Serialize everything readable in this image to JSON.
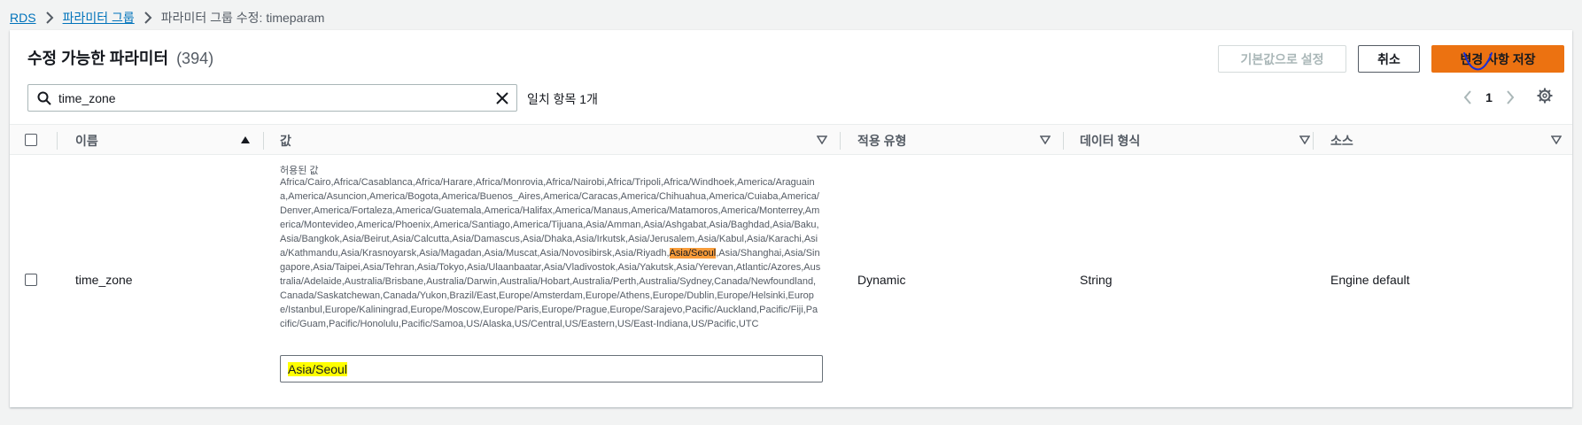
{
  "breadcrumb": {
    "root": "RDS",
    "parent": "파라미터 그룹",
    "current": "파라미터 그룹 수정: timeparam"
  },
  "panel": {
    "title": "수정 가능한 파라미터",
    "count": "(394)",
    "buttons": {
      "reset": "기본값으로 설정",
      "cancel": "취소",
      "save": "변경 사항 저장"
    }
  },
  "search": {
    "value": "time_zone",
    "match_text": "일치 항목 1개"
  },
  "pagination": {
    "current_page": "1"
  },
  "table": {
    "columns": {
      "name": "이름",
      "value": "값",
      "apply_type": "적용 유형",
      "data_type": "데이터 형식",
      "source": "소스"
    },
    "rows": [
      {
        "name": "time_zone",
        "allowed_label": "허용된 값",
        "allowed_before": "Africa/Cairo,Africa/Casablanca,Africa/Harare,Africa/Monrovia,Africa/Nairobi,Africa/Tripoli,Africa/Windhoek,America/Araguaina,America/Asuncion,America/Bogota,America/Buenos_Aires,America/Caracas,America/Chihuahua,America/Cuiaba,America/Denver,America/Fortaleza,America/Guatemala,America/Halifax,America/Manaus,America/Matamoros,America/Monterrey,America/Montevideo,America/Phoenix,America/Santiago,America/Tijuana,Asia/Amman,Asia/Ashgabat,Asia/Baghdad,Asia/Baku,Asia/Bangkok,Asia/Beirut,Asia/Calcutta,Asia/Damascus,Asia/Dhaka,Asia/Irkutsk,Asia/Jerusalem,Asia/Kabul,Asia/Karachi,Asia/Kathmandu,Asia/Krasnoyarsk,Asia/Magadan,Asia/Muscat,Asia/Novosibirsk,Asia/Riyadh,",
        "allowed_highlight": "Asia/Seoul",
        "allowed_after": ",Asia/Shanghai,Asia/Singapore,Asia/Taipei,Asia/Tehran,Asia/Tokyo,Asia/Ulaanbaatar,Asia/Vladivostok,Asia/Yakutsk,Asia/Yerevan,Atlantic/Azores,Australia/Adelaide,Australia/Brisbane,Australia/Darwin,Australia/Hobart,Australia/Perth,Australia/Sydney,Canada/Newfoundland,Canada/Saskatchewan,Canada/Yukon,Brazil/East,Europe/Amsterdam,Europe/Athens,Europe/Dublin,Europe/Helsinki,Europe/Istanbul,Europe/Kaliningrad,Europe/Moscow,Europe/Paris,Europe/Prague,Europe/Sarajevo,Pacific/Auckland,Pacific/Fiji,Pacific/Guam,Pacific/Honolulu,Pacific/Samoa,US/Alaska,US/Central,US/Eastern,US/East-Indiana,US/Pacific,UTC",
        "value": "Asia/Seoul",
        "apply_type": "Dynamic",
        "data_type": "String",
        "source": "Engine default"
      }
    ]
  },
  "colors": {
    "link": "#0073bb",
    "primary_button": "#ec7211",
    "highlight_orange": "#f89c3a",
    "highlight_yellow": "#ffff00",
    "pen_mark": "#1a2fd6"
  }
}
